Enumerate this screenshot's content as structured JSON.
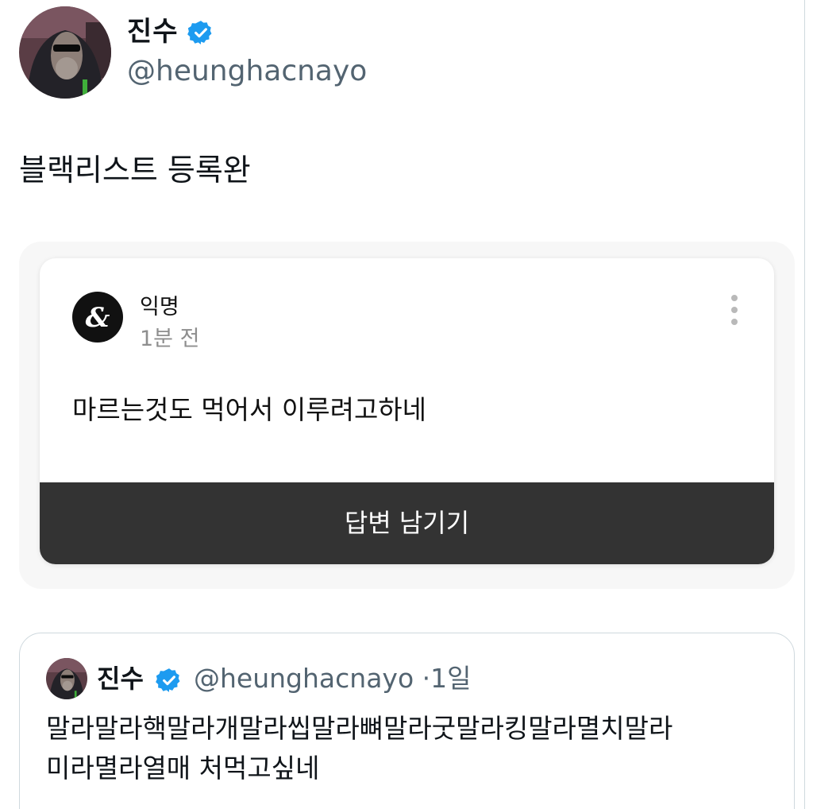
{
  "tweet": {
    "author": {
      "name": "진수",
      "handle": "@heunghacnayo",
      "verified": true,
      "avatar": "person-in-hood-with-sunglasses-avatar"
    },
    "text": "블랙리스트 등록완"
  },
  "question_card": {
    "sender_name": "익명",
    "time": "1분 전",
    "question": "마르는것도 먹어서 이루려고하네",
    "answer_button_label": "답변 남기기",
    "more_icon": "vertical-ellipsis-icon"
  },
  "quoted_tweet": {
    "author_name": "진수",
    "handle": "@heunghacnayo",
    "separator": "·",
    "age": "1일",
    "text_line1": "말라말라핵말라개말라씹말라뼈말라굿말라킹말라멸치말라",
    "text_line2": "미라멸라열매 처먹고싶네"
  },
  "colors": {
    "verified_blue": "#1d9bf0",
    "secondary_text": "#536471",
    "button_dark": "#333333",
    "card_bg": "#f7f7f7"
  }
}
